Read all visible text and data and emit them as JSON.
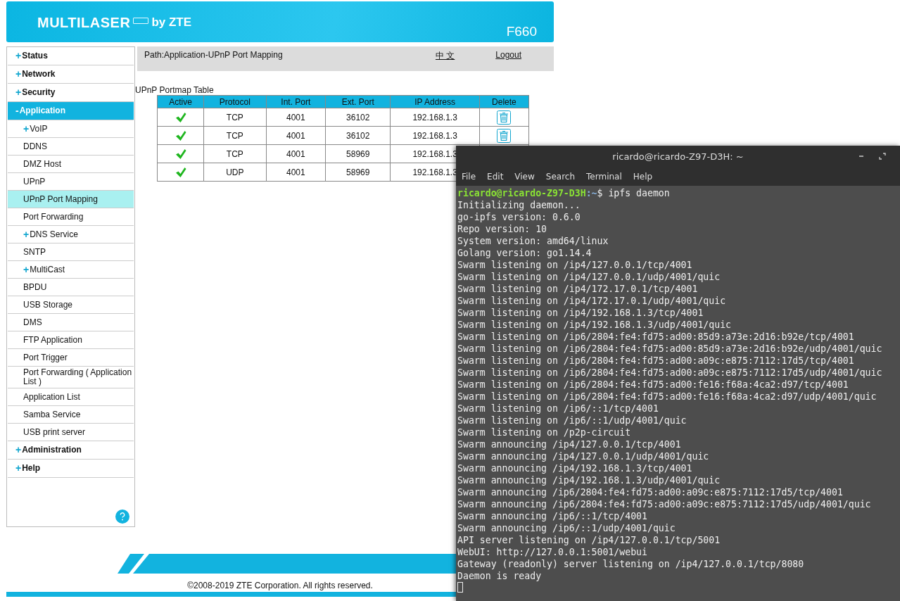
{
  "router": {
    "brand": "MULTILASER",
    "brand_suffix": "by ZTE",
    "model": "F660",
    "path": "Path:Application-UPnP Port Mapping",
    "language_link": "中 文",
    "logout_link": "Logout",
    "sidebar": [
      {
        "kind": "top",
        "marker": "+",
        "label": "Status",
        "selected": false
      },
      {
        "kind": "top",
        "marker": "+",
        "label": "Network",
        "selected": false
      },
      {
        "kind": "top",
        "marker": "+",
        "label": "Security",
        "selected": false
      },
      {
        "kind": "top",
        "marker": "-",
        "label": "Application",
        "selected": true
      },
      {
        "kind": "sub",
        "marker": "+",
        "label": "VoIP",
        "selected": false
      },
      {
        "kind": "sub",
        "label": "DDNS",
        "selected": false
      },
      {
        "kind": "sub",
        "label": "DMZ Host",
        "selected": false
      },
      {
        "kind": "sub",
        "label": "UPnP",
        "selected": false
      },
      {
        "kind": "sub",
        "label": "UPnP Port Mapping",
        "selected": true
      },
      {
        "kind": "sub",
        "label": "Port Forwarding",
        "selected": false
      },
      {
        "kind": "sub",
        "marker": "+",
        "label": "DNS Service",
        "selected": false
      },
      {
        "kind": "sub",
        "label": "SNTP",
        "selected": false
      },
      {
        "kind": "sub",
        "marker": "+",
        "label": "MultiCast",
        "selected": false
      },
      {
        "kind": "sub",
        "label": "BPDU",
        "selected": false
      },
      {
        "kind": "sub",
        "label": "USB Storage",
        "selected": false
      },
      {
        "kind": "sub",
        "label": "DMS",
        "selected": false
      },
      {
        "kind": "sub",
        "label": "FTP Application",
        "selected": false
      },
      {
        "kind": "sub",
        "label": "Port Trigger",
        "selected": false
      },
      {
        "kind": "sub",
        "label": "Port Forwarding ( Application List )",
        "selected": false
      },
      {
        "kind": "sub",
        "label": "Application List",
        "selected": false
      },
      {
        "kind": "sub",
        "label": "Samba Service",
        "selected": false
      },
      {
        "kind": "sub",
        "label": "USB print server",
        "selected": false
      },
      {
        "kind": "top",
        "marker": "+",
        "label": "Administration",
        "selected": false
      },
      {
        "kind": "top",
        "marker": "+",
        "label": "Help",
        "selected": false
      }
    ],
    "table": {
      "title": "UPnP Portmap Table",
      "columns": [
        "Active",
        "Protocol",
        "Int. Port",
        "Ext. Port",
        "IP Address",
        "Delete"
      ],
      "rows": [
        {
          "active": true,
          "protocol": "TCP",
          "int_port": "4001",
          "ext_port": "36102",
          "ip_address": "192.168.1.3",
          "delete": true
        },
        {
          "active": true,
          "protocol": "TCP",
          "int_port": "4001",
          "ext_port": "36102",
          "ip_address": "192.168.1.3",
          "delete": true
        },
        {
          "active": true,
          "protocol": "TCP",
          "int_port": "4001",
          "ext_port": "58969",
          "ip_address": "192.168.1.3"
        },
        {
          "active": true,
          "protocol": "UDP",
          "int_port": "4001",
          "ext_port": "58969",
          "ip_address": "192.168.1.3"
        }
      ]
    },
    "copyright": "©2008-2019 ZTE Corporation. All rights reserved."
  },
  "terminal": {
    "title": "ricardo@ricardo-Z97-D3H: ~",
    "menu": [
      "File",
      "Edit",
      "View",
      "Search",
      "Terminal",
      "Help"
    ],
    "prompt": {
      "user_host": "ricardo@ricardo-Z97-D3H",
      "path": ":~",
      "command": "$ ipfs daemon"
    },
    "output": [
      "Initializing daemon...",
      "go-ipfs version: 0.6.0",
      "Repo version: 10",
      "System version: amd64/linux",
      "Golang version: go1.14.4",
      "Swarm listening on /ip4/127.0.0.1/tcp/4001",
      "Swarm listening on /ip4/127.0.0.1/udp/4001/quic",
      "Swarm listening on /ip4/172.17.0.1/tcp/4001",
      "Swarm listening on /ip4/172.17.0.1/udp/4001/quic",
      "Swarm listening on /ip4/192.168.1.3/tcp/4001",
      "Swarm listening on /ip4/192.168.1.3/udp/4001/quic",
      "Swarm listening on /ip6/2804:fe4:fd75:ad00:85d9:a73e:2d16:b92e/tcp/4001",
      "Swarm listening on /ip6/2804:fe4:fd75:ad00:85d9:a73e:2d16:b92e/udp/4001/quic",
      "Swarm listening on /ip6/2804:fe4:fd75:ad00:a09c:e875:7112:17d5/tcp/4001",
      "Swarm listening on /ip6/2804:fe4:fd75:ad00:a09c:e875:7112:17d5/udp/4001/quic",
      "Swarm listening on /ip6/2804:fe4:fd75:ad00:fe16:f68a:4ca2:d97/tcp/4001",
      "Swarm listening on /ip6/2804:fe4:fd75:ad00:fe16:f68a:4ca2:d97/udp/4001/quic",
      "Swarm listening on /ip6/::1/tcp/4001",
      "Swarm listening on /ip6/::1/udp/4001/quic",
      "Swarm listening on /p2p-circuit",
      "Swarm announcing /ip4/127.0.0.1/tcp/4001",
      "Swarm announcing /ip4/127.0.0.1/udp/4001/quic",
      "Swarm announcing /ip4/192.168.1.3/tcp/4001",
      "Swarm announcing /ip4/192.168.1.3/udp/4001/quic",
      "Swarm announcing /ip6/2804:fe4:fd75:ad00:a09c:e875:7112:17d5/tcp/4001",
      "Swarm announcing /ip6/2804:fe4:fd75:ad00:a09c:e875:7112:17d5/udp/4001/quic",
      "Swarm announcing /ip6/::1/tcp/4001",
      "Swarm announcing /ip6/::1/udp/4001/quic",
      "API server listening on /ip4/127.0.0.1/tcp/5001",
      "WebUI: http://127.0.0.1:5001/webui",
      "Gateway (readonly) server listening on /ip4/127.0.0.1/tcp/8080",
      "Daemon is ready"
    ]
  }
}
